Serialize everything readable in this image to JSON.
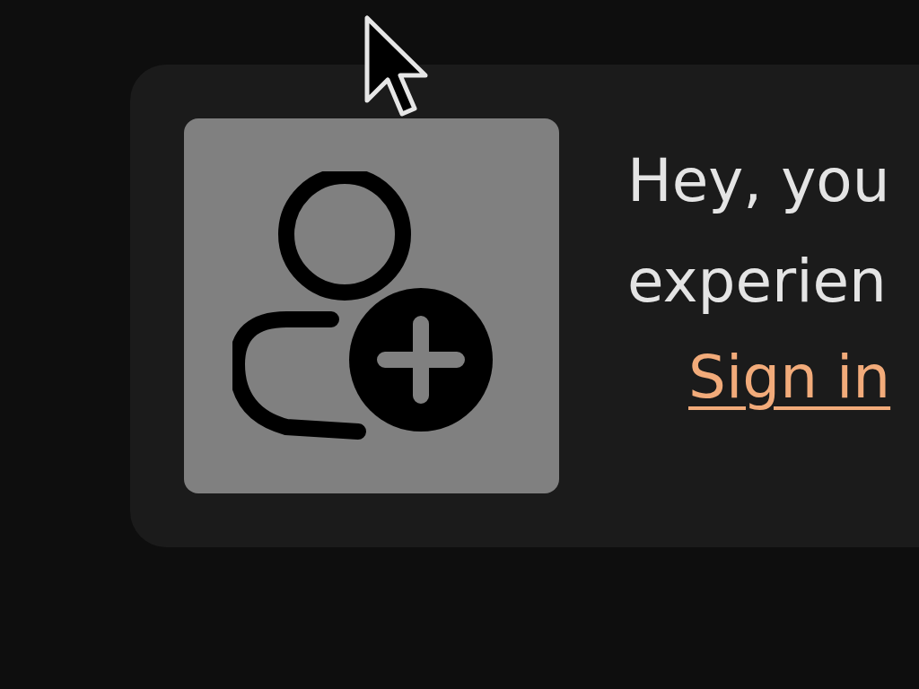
{
  "card": {
    "heading": [
      "Hey, you",
      "experien"
    ],
    "link": "Sign in"
  }
}
